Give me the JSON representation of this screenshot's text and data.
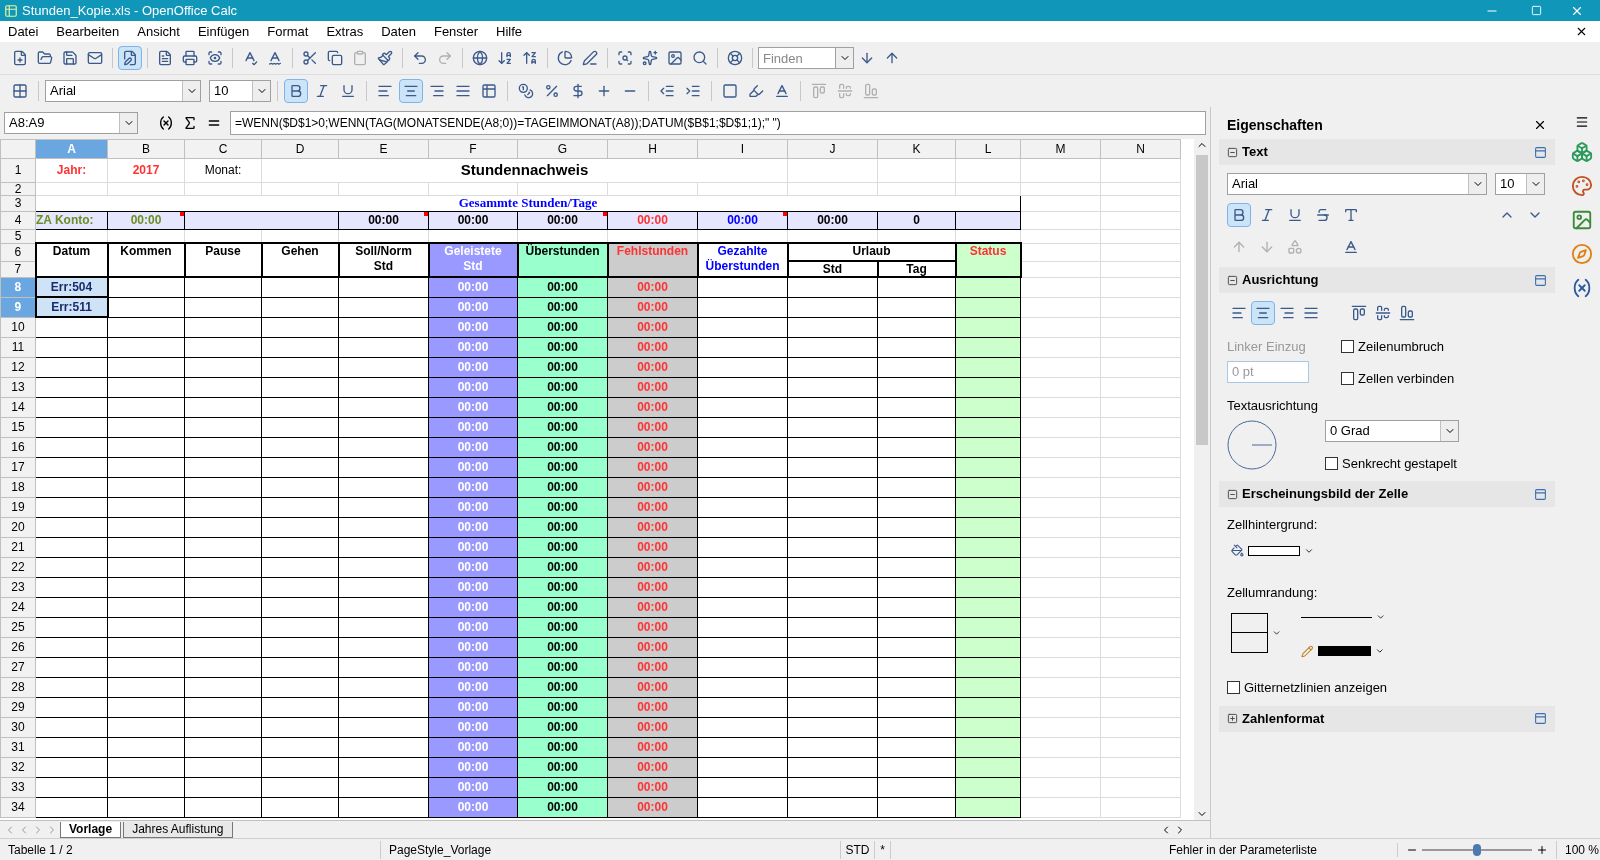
{
  "window": {
    "title": "Stunden_Kopie.xls - OpenOffice Calc"
  },
  "menu": [
    "Datei",
    "Bearbeiten",
    "Ansicht",
    "Einfügen",
    "Format",
    "Extras",
    "Daten",
    "Fenster",
    "Hilfe"
  ],
  "standard_toolbar": {
    "edit_mode": true
  },
  "find": {
    "placeholder": "Finden"
  },
  "format_toolbar": {
    "font": "Arial",
    "size": "10",
    "bold": true,
    "align_left": false,
    "align_center": true,
    "align_right": false,
    "justify": false
  },
  "formula_bar": {
    "name_box": "A8:A9",
    "formula": "=WENN($D$1>0;WENN(TAG(MONATSENDE(A8;0))=TAGEIMMONAT(A8));DATUM($B$1;$D$1;1);\" \")"
  },
  "columns": [
    {
      "label": "A",
      "selected": true
    },
    {
      "label": "B",
      "selected": false
    },
    {
      "label": "C",
      "selected": false
    },
    {
      "label": "D",
      "selected": false
    },
    {
      "label": "E",
      "selected": false
    },
    {
      "label": "F",
      "selected": false
    },
    {
      "label": "G",
      "selected": false
    },
    {
      "label": "H",
      "selected": false
    },
    {
      "label": "I",
      "selected": false
    },
    {
      "label": "J",
      "selected": false
    },
    {
      "label": "K",
      "selected": false
    },
    {
      "label": "L",
      "selected": false
    },
    {
      "label": "M",
      "selected": false
    },
    {
      "label": "N",
      "selected": false
    }
  ],
  "head_row_numbers": [
    "1",
    "2",
    "3",
    "4",
    "5",
    "6",
    "7"
  ],
  "top": {
    "year_label": "Jahr:",
    "year": "2017",
    "month_label": "Monat:",
    "title": "Stundennachweis",
    "summary_title": "Gesammte Stunden/Tage",
    "account_label": "ZA Konto:",
    "account_value": "00:00",
    "account_comment": true
  },
  "totals": [
    {
      "text": "00:00",
      "color": "#000000",
      "comment": true
    },
    {
      "text": "00:00",
      "color": "#000000",
      "comment": false
    },
    {
      "text": "00:00",
      "color": "#000000",
      "comment": true
    },
    {
      "text": "00:00",
      "color": "#ff3333",
      "comment": false
    },
    {
      "text": "00:00",
      "color": "#0000ff",
      "comment": true
    },
    {
      "text": "00:00",
      "color": "#000000",
      "comment": false
    },
    {
      "text": "0",
      "color": "#000000",
      "comment": false
    }
  ],
  "headers": [
    {
      "text": "Datum",
      "color": "#000000"
    },
    {
      "text": "Kommen",
      "color": "#000000"
    },
    {
      "text": "Pause",
      "color": "#000000"
    },
    {
      "text": "Gehen",
      "color": "#000000"
    },
    {
      "text": "Soll/Norm Std",
      "color": "#000000"
    },
    {
      "text": "Geleistete Std",
      "color": "#ffffff"
    },
    {
      "text": "Überstunden",
      "color": "#000000"
    },
    {
      "text": "Fehlstunden",
      "color": "#ff3333"
    },
    {
      "text": "Gezahlte Überstunden",
      "color": "#0000ff"
    },
    {
      "text": "Urlaub",
      "color": "#000000",
      "children": [
        "Std",
        "Tag"
      ]
    },
    {
      "text": "Status",
      "color": "#ff3333"
    }
  ],
  "rows": [
    {
      "number": "8",
      "selected": true,
      "date": "Err:504",
      "worked": "00:00",
      "overtime": "00:00",
      "missing": "00:00"
    },
    {
      "number": "9",
      "selected": true,
      "date": "Err:511",
      "worked": "00:00",
      "overtime": "00:00",
      "missing": "00:00"
    },
    {
      "number": "10",
      "selected": false,
      "worked": "00:00",
      "overtime": "00:00",
      "missing": "00:00"
    },
    {
      "number": "11",
      "selected": false,
      "worked": "00:00",
      "overtime": "00:00",
      "missing": "00:00"
    },
    {
      "number": "12",
      "selected": false,
      "worked": "00:00",
      "overtime": "00:00",
      "missing": "00:00"
    },
    {
      "number": "13",
      "selected": false,
      "worked": "00:00",
      "overtime": "00:00",
      "missing": "00:00"
    },
    {
      "number": "14",
      "selected": false,
      "worked": "00:00",
      "overtime": "00:00",
      "missing": "00:00"
    },
    {
      "number": "15",
      "selected": false,
      "worked": "00:00",
      "overtime": "00:00",
      "missing": "00:00"
    },
    {
      "number": "16",
      "selected": false,
      "worked": "00:00",
      "overtime": "00:00",
      "missing": "00:00"
    },
    {
      "number": "17",
      "selected": false,
      "worked": "00:00",
      "overtime": "00:00",
      "missing": "00:00"
    },
    {
      "number": "18",
      "selected": false,
      "worked": "00:00",
      "overtime": "00:00",
      "missing": "00:00"
    },
    {
      "number": "19",
      "selected": false,
      "worked": "00:00",
      "overtime": "00:00",
      "missing": "00:00"
    },
    {
      "number": "20",
      "selected": false,
      "worked": "00:00",
      "overtime": "00:00",
      "missing": "00:00"
    },
    {
      "number": "21",
      "selected": false,
      "worked": "00:00",
      "overtime": "00:00",
      "missing": "00:00"
    },
    {
      "number": "22",
      "selected": false,
      "worked": "00:00",
      "overtime": "00:00",
      "missing": "00:00"
    },
    {
      "number": "23",
      "selected": false,
      "worked": "00:00",
      "overtime": "00:00",
      "missing": "00:00"
    },
    {
      "number": "24",
      "selected": false,
      "worked": "00:00",
      "overtime": "00:00",
      "missing": "00:00"
    },
    {
      "number": "25",
      "selected": false,
      "worked": "00:00",
      "overtime": "00:00",
      "missing": "00:00"
    },
    {
      "number": "26",
      "selected": false,
      "worked": "00:00",
      "overtime": "00:00",
      "missing": "00:00"
    },
    {
      "number": "27",
      "selected": false,
      "worked": "00:00",
      "overtime": "00:00",
      "missing": "00:00"
    },
    {
      "number": "28",
      "selected": false,
      "worked": "00:00",
      "overtime": "00:00",
      "missing": "00:00"
    },
    {
      "number": "29",
      "selected": false,
      "worked": "00:00",
      "overtime": "00:00",
      "missing": "00:00"
    },
    {
      "number": "30",
      "selected": false,
      "worked": "00:00",
      "overtime": "00:00",
      "missing": "00:00"
    },
    {
      "number": "31",
      "selected": false,
      "worked": "00:00",
      "overtime": "00:00",
      "missing": "00:00"
    },
    {
      "number": "32",
      "selected": false,
      "worked": "00:00",
      "overtime": "00:00",
      "missing": "00:00"
    },
    {
      "number": "33",
      "selected": false,
      "worked": "00:00",
      "overtime": "00:00",
      "missing": "00:00"
    },
    {
      "number": "34",
      "selected": false,
      "worked": "00:00",
      "overtime": "00:00",
      "missing": "00:00"
    }
  ],
  "sheet_tabs": [
    {
      "label": "Vorlage",
      "selected": true
    },
    {
      "label": "Jahres Auflistung",
      "selected": false
    }
  ],
  "status_bar": {
    "sheet": "Tabelle 1 / 2",
    "page_style": "PageStyle_Vorlage",
    "mode": "STD",
    "modified": "*",
    "message": "Fehler in der Parameterliste",
    "zoom": "100 %",
    "zoom_slider": {
      "level": 0.5
    }
  },
  "sidebar": {
    "title": "Eigenschaften",
    "text": {
      "title": "Text",
      "expanded": true,
      "font": "Arial",
      "size": "10",
      "bold": true
    },
    "alignment": {
      "title": "Ausrichtung",
      "expanded": true,
      "align_left": false,
      "align_center": true,
      "align_right": false,
      "justify": false,
      "indent_label": "Linker Einzug",
      "indent_value": "0 pt",
      "checkboxes": [
        {
          "label": "Zeilenumbruch",
          "checked": false
        },
        {
          "label": "Zellen verbinden",
          "checked": false
        }
      ],
      "orientation_label": "Textausrichtung",
      "angle": "0 Grad",
      "stacked": {
        "label": "Senkrecht gestapelt",
        "checked": false
      }
    },
    "appearance": {
      "title": "Erscheinungsbild der Zelle",
      "expanded": true,
      "background_label": "Zellhintergrund:",
      "border_label": "Zellumrandung:",
      "gridlines": {
        "label": "Gitternetzlinien anzeigen",
        "checked": false
      }
    },
    "number_format": {
      "title": "Zahlenformat",
      "expanded": false
    }
  }
}
